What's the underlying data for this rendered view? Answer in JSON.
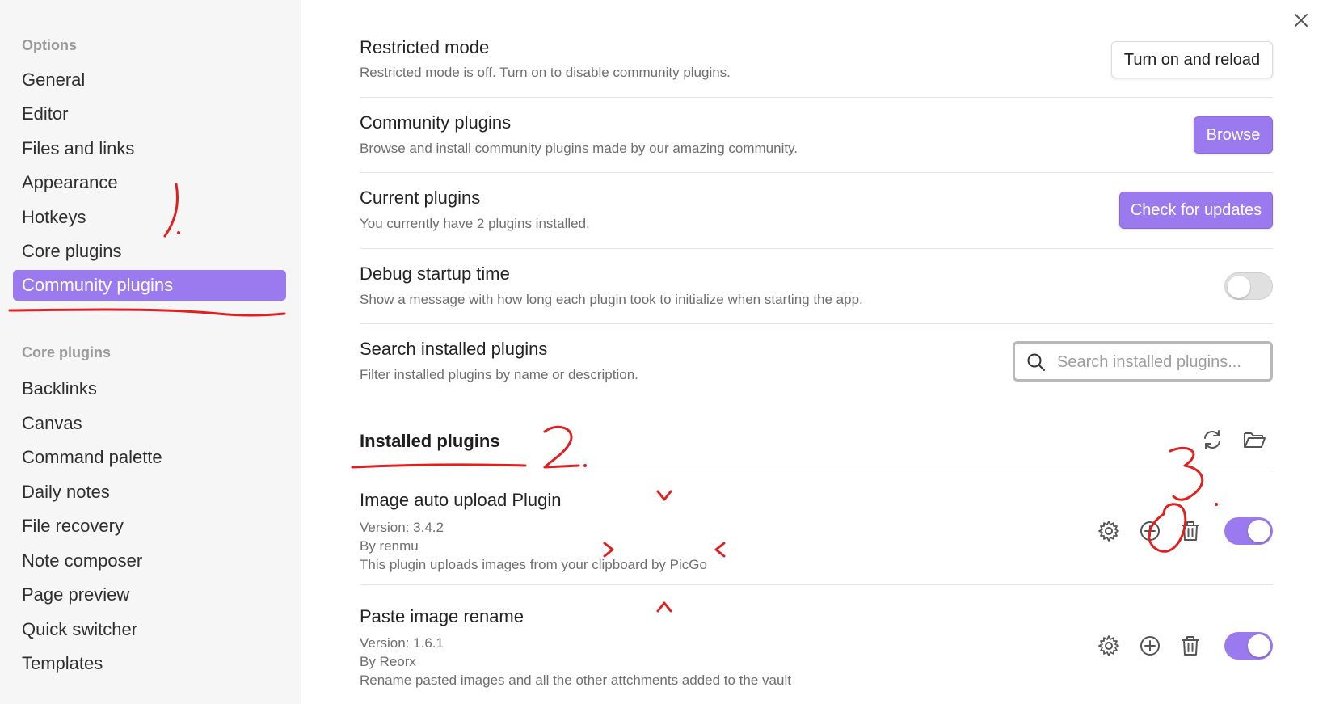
{
  "sidebar": {
    "options_heading": "Options",
    "options_items": [
      {
        "label": "General"
      },
      {
        "label": "Editor"
      },
      {
        "label": "Files and links"
      },
      {
        "label": "Appearance"
      },
      {
        "label": "Hotkeys"
      },
      {
        "label": "Core plugins"
      },
      {
        "label": "Community plugins",
        "active": true
      }
    ],
    "core_heading": "Core plugins",
    "core_items": [
      {
        "label": "Backlinks"
      },
      {
        "label": "Canvas"
      },
      {
        "label": "Command palette"
      },
      {
        "label": "Daily notes"
      },
      {
        "label": "File recovery"
      },
      {
        "label": "Note composer"
      },
      {
        "label": "Page preview"
      },
      {
        "label": "Quick switcher"
      },
      {
        "label": "Templates"
      }
    ]
  },
  "settings": {
    "restricted": {
      "name": "Restricted mode",
      "desc": "Restricted mode is off. Turn on to disable community plugins.",
      "button": "Turn on and reload"
    },
    "community": {
      "name": "Community plugins",
      "desc": "Browse and install community plugins made by our amazing community.",
      "button": "Browse"
    },
    "current": {
      "name": "Current plugins",
      "desc": "You currently have 2 plugins installed.",
      "button": "Check for updates"
    },
    "debug": {
      "name": "Debug startup time",
      "desc": "Show a message with how long each plugin took to initialize when starting the app.",
      "toggle": false
    },
    "search": {
      "name": "Search installed plugins",
      "desc": "Filter installed plugins by name or description.",
      "placeholder": "Search installed plugins..."
    }
  },
  "installed": {
    "title": "Installed plugins",
    "plugins": [
      {
        "name": "Image auto upload Plugin",
        "version": "Version: 3.4.2",
        "author": "By renmu",
        "desc": "This plugin uploads images from your clipboard by PicGo",
        "enabled": true
      },
      {
        "name": "Paste image rename",
        "version": "Version: 1.6.1",
        "author": "By Reorx",
        "desc": "Rename pasted images and all the other attchments added to the vault",
        "enabled": true
      }
    ]
  },
  "annotations": {
    "one": "1.",
    "two": "2.",
    "three": "3."
  },
  "colors": {
    "accent": "#9b79ef",
    "annotation": "#e02020"
  },
  "icons": [
    "close-icon",
    "search-icon",
    "reload-icon",
    "folder-icon",
    "gear-icon",
    "plus-circle-icon",
    "trash-icon"
  ]
}
